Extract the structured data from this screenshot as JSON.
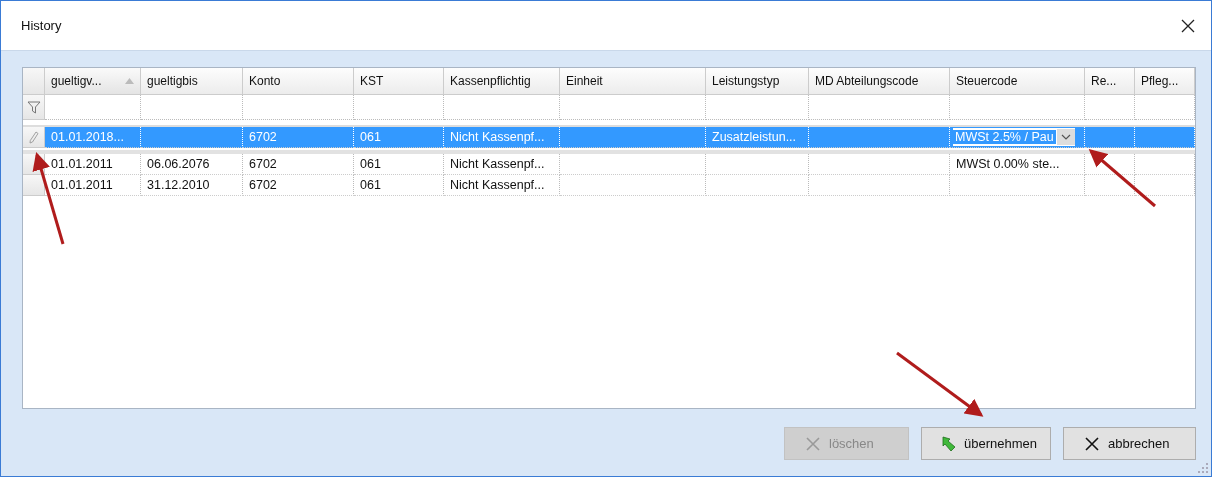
{
  "window": {
    "title": "History"
  },
  "grid": {
    "columns": [
      {
        "label": "gueltigv...",
        "sorted": true
      },
      {
        "label": "gueltigbis",
        "sorted": false
      },
      {
        "label": "Konto",
        "sorted": false
      },
      {
        "label": "KST",
        "sorted": false
      },
      {
        "label": "Kassenpflichtig",
        "sorted": false
      },
      {
        "label": "Einheit",
        "sorted": false
      },
      {
        "label": "Leistungstyp",
        "sorted": false
      },
      {
        "label": "MD Abteilungscode",
        "sorted": false
      },
      {
        "label": "Steuercode",
        "sorted": false
      },
      {
        "label": "Re...",
        "sorted": false
      },
      {
        "label": "Pfleg...",
        "sorted": false
      }
    ],
    "rows": [
      {
        "selected": true,
        "editing": true,
        "cells": [
          "01.01.2018...",
          "",
          "6702",
          "061",
          "Nicht Kassenpf...",
          "",
          "Zusatzleistun...",
          "",
          {
            "kind": "dropdown",
            "value": "MWSt 2.5% / Pau"
          },
          "",
          ""
        ]
      },
      {
        "selected": false,
        "editing": false,
        "cells": [
          "01.01.2011",
          "06.06.2076",
          "6702",
          "061",
          "Nicht Kassenpf...",
          "",
          "",
          "",
          "MWSt  0.00%  ste...",
          "",
          ""
        ]
      },
      {
        "selected": false,
        "editing": false,
        "cells": [
          "01.01.2011",
          "31.12.2010",
          "6702",
          "061",
          "Nicht Kassenpf...",
          "",
          "",
          "",
          "",
          "",
          ""
        ]
      }
    ]
  },
  "buttons": [
    {
      "label": "löschen",
      "kind": "delete",
      "disabled": true
    },
    {
      "label": "übernehmen",
      "kind": "apply",
      "disabled": false
    },
    {
      "label": "abbrechen",
      "kind": "cancel",
      "disabled": false
    }
  ]
}
